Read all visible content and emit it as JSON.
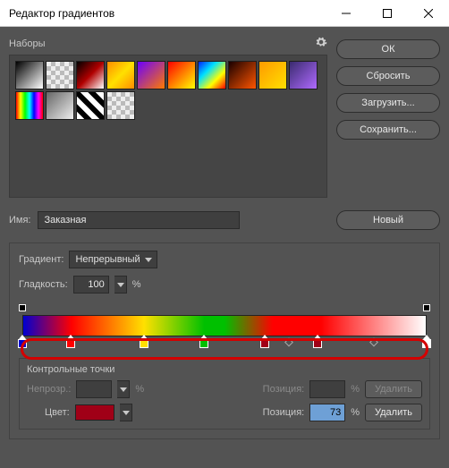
{
  "window": {
    "title": "Редактор градиентов"
  },
  "presets": {
    "label": "Наборы",
    "swatches": [
      "linear-gradient(135deg,#000,#fff)",
      "checker",
      "linear-gradient(135deg,#000,#b00000,#fff)",
      "linear-gradient(135deg,#ff8c00,#ffe000,#ff8c00)",
      "linear-gradient(135deg,#6a00ff,#ff7a00)",
      "linear-gradient(135deg,#ff0000,#ffff00)",
      "linear-gradient(135deg,#0024ff,#00e0ff,#ffff00,#ff0000)",
      "linear-gradient(135deg,#1a0000,#ff5500)",
      "linear-gradient(135deg,#ff9a00,#ffe000)",
      "linear-gradient(135deg,#3a2b6f,#b06aff)",
      "linear-gradient(90deg,#ff0000,#ffff00,#00ff00,#00ffff,#0000ff,#ff00ff,#ff0000)",
      "linear-gradient(135deg,#666,#eee)",
      "repeating-linear-gradient(45deg,#fff 0 6px,#000 6px 12px)",
      "checker"
    ]
  },
  "buttons": {
    "ok": "ОК",
    "reset": "Сбросить",
    "load": "Загрузить...",
    "save": "Сохранить...",
    "new": "Новый"
  },
  "name": {
    "label": "Имя:",
    "value": "Заказная"
  },
  "type": {
    "label": "Градиент:",
    "value": "Непрерывный"
  },
  "smoothness": {
    "label": "Гладкость:",
    "value": "100",
    "unit": "%"
  },
  "gradient": {
    "css": "linear-gradient(90deg,#0000d0 0%,#ff0000 12%,#ffe000 30%,#00c000 45%,#00c000 50%,#ff0000 62%,#ff0000 74%,#ffffff 100%)",
    "opacityStops": [
      0,
      100
    ],
    "colorStops": [
      {
        "pos": 0,
        "color": "#0000d0"
      },
      {
        "pos": 12,
        "color": "#ff0000"
      },
      {
        "pos": 30,
        "color": "#ffe000"
      },
      {
        "pos": 45,
        "color": "#00c000"
      },
      {
        "pos": 60,
        "color": "#a00017"
      },
      {
        "pos": 73,
        "color": "#a00017"
      },
      {
        "pos": 100,
        "color": "#ffffff"
      }
    ],
    "midpoints": [
      66,
      87
    ]
  },
  "stops": {
    "heading": "Контрольные точки",
    "opacity": {
      "label": "Непрозр.:",
      "value": "",
      "unit": "%",
      "posLabel": "Позиция:",
      "posValue": "",
      "deleteLabel": "Удалить"
    },
    "color": {
      "label": "Цвет:",
      "value": "#a00017",
      "posLabel": "Позиция:",
      "posValue": "73",
      "unit": "%",
      "deleteLabel": "Удалить"
    }
  }
}
